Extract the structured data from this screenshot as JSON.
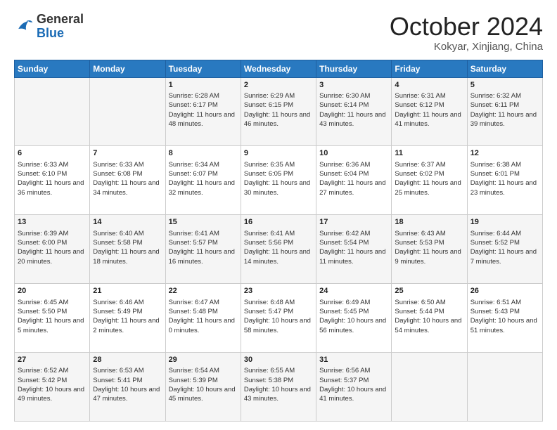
{
  "header": {
    "logo_general": "General",
    "logo_blue": "Blue",
    "month_title": "October 2024",
    "location": "Kokyar, Xinjiang, China"
  },
  "weekdays": [
    "Sunday",
    "Monday",
    "Tuesday",
    "Wednesday",
    "Thursday",
    "Friday",
    "Saturday"
  ],
  "weeks": [
    [
      {
        "day": "",
        "sunrise": "",
        "sunset": "",
        "daylight": ""
      },
      {
        "day": "",
        "sunrise": "",
        "sunset": "",
        "daylight": ""
      },
      {
        "day": "1",
        "sunrise": "Sunrise: 6:28 AM",
        "sunset": "Sunset: 6:17 PM",
        "daylight": "Daylight: 11 hours and 48 minutes."
      },
      {
        "day": "2",
        "sunrise": "Sunrise: 6:29 AM",
        "sunset": "Sunset: 6:15 PM",
        "daylight": "Daylight: 11 hours and 46 minutes."
      },
      {
        "day": "3",
        "sunrise": "Sunrise: 6:30 AM",
        "sunset": "Sunset: 6:14 PM",
        "daylight": "Daylight: 11 hours and 43 minutes."
      },
      {
        "day": "4",
        "sunrise": "Sunrise: 6:31 AM",
        "sunset": "Sunset: 6:12 PM",
        "daylight": "Daylight: 11 hours and 41 minutes."
      },
      {
        "day": "5",
        "sunrise": "Sunrise: 6:32 AM",
        "sunset": "Sunset: 6:11 PM",
        "daylight": "Daylight: 11 hours and 39 minutes."
      }
    ],
    [
      {
        "day": "6",
        "sunrise": "Sunrise: 6:33 AM",
        "sunset": "Sunset: 6:10 PM",
        "daylight": "Daylight: 11 hours and 36 minutes."
      },
      {
        "day": "7",
        "sunrise": "Sunrise: 6:33 AM",
        "sunset": "Sunset: 6:08 PM",
        "daylight": "Daylight: 11 hours and 34 minutes."
      },
      {
        "day": "8",
        "sunrise": "Sunrise: 6:34 AM",
        "sunset": "Sunset: 6:07 PM",
        "daylight": "Daylight: 11 hours and 32 minutes."
      },
      {
        "day": "9",
        "sunrise": "Sunrise: 6:35 AM",
        "sunset": "Sunset: 6:05 PM",
        "daylight": "Daylight: 11 hours and 30 minutes."
      },
      {
        "day": "10",
        "sunrise": "Sunrise: 6:36 AM",
        "sunset": "Sunset: 6:04 PM",
        "daylight": "Daylight: 11 hours and 27 minutes."
      },
      {
        "day": "11",
        "sunrise": "Sunrise: 6:37 AM",
        "sunset": "Sunset: 6:02 PM",
        "daylight": "Daylight: 11 hours and 25 minutes."
      },
      {
        "day": "12",
        "sunrise": "Sunrise: 6:38 AM",
        "sunset": "Sunset: 6:01 PM",
        "daylight": "Daylight: 11 hours and 23 minutes."
      }
    ],
    [
      {
        "day": "13",
        "sunrise": "Sunrise: 6:39 AM",
        "sunset": "Sunset: 6:00 PM",
        "daylight": "Daylight: 11 hours and 20 minutes."
      },
      {
        "day": "14",
        "sunrise": "Sunrise: 6:40 AM",
        "sunset": "Sunset: 5:58 PM",
        "daylight": "Daylight: 11 hours and 18 minutes."
      },
      {
        "day": "15",
        "sunrise": "Sunrise: 6:41 AM",
        "sunset": "Sunset: 5:57 PM",
        "daylight": "Daylight: 11 hours and 16 minutes."
      },
      {
        "day": "16",
        "sunrise": "Sunrise: 6:41 AM",
        "sunset": "Sunset: 5:56 PM",
        "daylight": "Daylight: 11 hours and 14 minutes."
      },
      {
        "day": "17",
        "sunrise": "Sunrise: 6:42 AM",
        "sunset": "Sunset: 5:54 PM",
        "daylight": "Daylight: 11 hours and 11 minutes."
      },
      {
        "day": "18",
        "sunrise": "Sunrise: 6:43 AM",
        "sunset": "Sunset: 5:53 PM",
        "daylight": "Daylight: 11 hours and 9 minutes."
      },
      {
        "day": "19",
        "sunrise": "Sunrise: 6:44 AM",
        "sunset": "Sunset: 5:52 PM",
        "daylight": "Daylight: 11 hours and 7 minutes."
      }
    ],
    [
      {
        "day": "20",
        "sunrise": "Sunrise: 6:45 AM",
        "sunset": "Sunset: 5:50 PM",
        "daylight": "Daylight: 11 hours and 5 minutes."
      },
      {
        "day": "21",
        "sunrise": "Sunrise: 6:46 AM",
        "sunset": "Sunset: 5:49 PM",
        "daylight": "Daylight: 11 hours and 2 minutes."
      },
      {
        "day": "22",
        "sunrise": "Sunrise: 6:47 AM",
        "sunset": "Sunset: 5:48 PM",
        "daylight": "Daylight: 11 hours and 0 minutes."
      },
      {
        "day": "23",
        "sunrise": "Sunrise: 6:48 AM",
        "sunset": "Sunset: 5:47 PM",
        "daylight": "Daylight: 10 hours and 58 minutes."
      },
      {
        "day": "24",
        "sunrise": "Sunrise: 6:49 AM",
        "sunset": "Sunset: 5:45 PM",
        "daylight": "Daylight: 10 hours and 56 minutes."
      },
      {
        "day": "25",
        "sunrise": "Sunrise: 6:50 AM",
        "sunset": "Sunset: 5:44 PM",
        "daylight": "Daylight: 10 hours and 54 minutes."
      },
      {
        "day": "26",
        "sunrise": "Sunrise: 6:51 AM",
        "sunset": "Sunset: 5:43 PM",
        "daylight": "Daylight: 10 hours and 51 minutes."
      }
    ],
    [
      {
        "day": "27",
        "sunrise": "Sunrise: 6:52 AM",
        "sunset": "Sunset: 5:42 PM",
        "daylight": "Daylight: 10 hours and 49 minutes."
      },
      {
        "day": "28",
        "sunrise": "Sunrise: 6:53 AM",
        "sunset": "Sunset: 5:41 PM",
        "daylight": "Daylight: 10 hours and 47 minutes."
      },
      {
        "day": "29",
        "sunrise": "Sunrise: 6:54 AM",
        "sunset": "Sunset: 5:39 PM",
        "daylight": "Daylight: 10 hours and 45 minutes."
      },
      {
        "day": "30",
        "sunrise": "Sunrise: 6:55 AM",
        "sunset": "Sunset: 5:38 PM",
        "daylight": "Daylight: 10 hours and 43 minutes."
      },
      {
        "day": "31",
        "sunrise": "Sunrise: 6:56 AM",
        "sunset": "Sunset: 5:37 PM",
        "daylight": "Daylight: 10 hours and 41 minutes."
      },
      {
        "day": "",
        "sunrise": "",
        "sunset": "",
        "daylight": ""
      },
      {
        "day": "",
        "sunrise": "",
        "sunset": "",
        "daylight": ""
      }
    ]
  ]
}
